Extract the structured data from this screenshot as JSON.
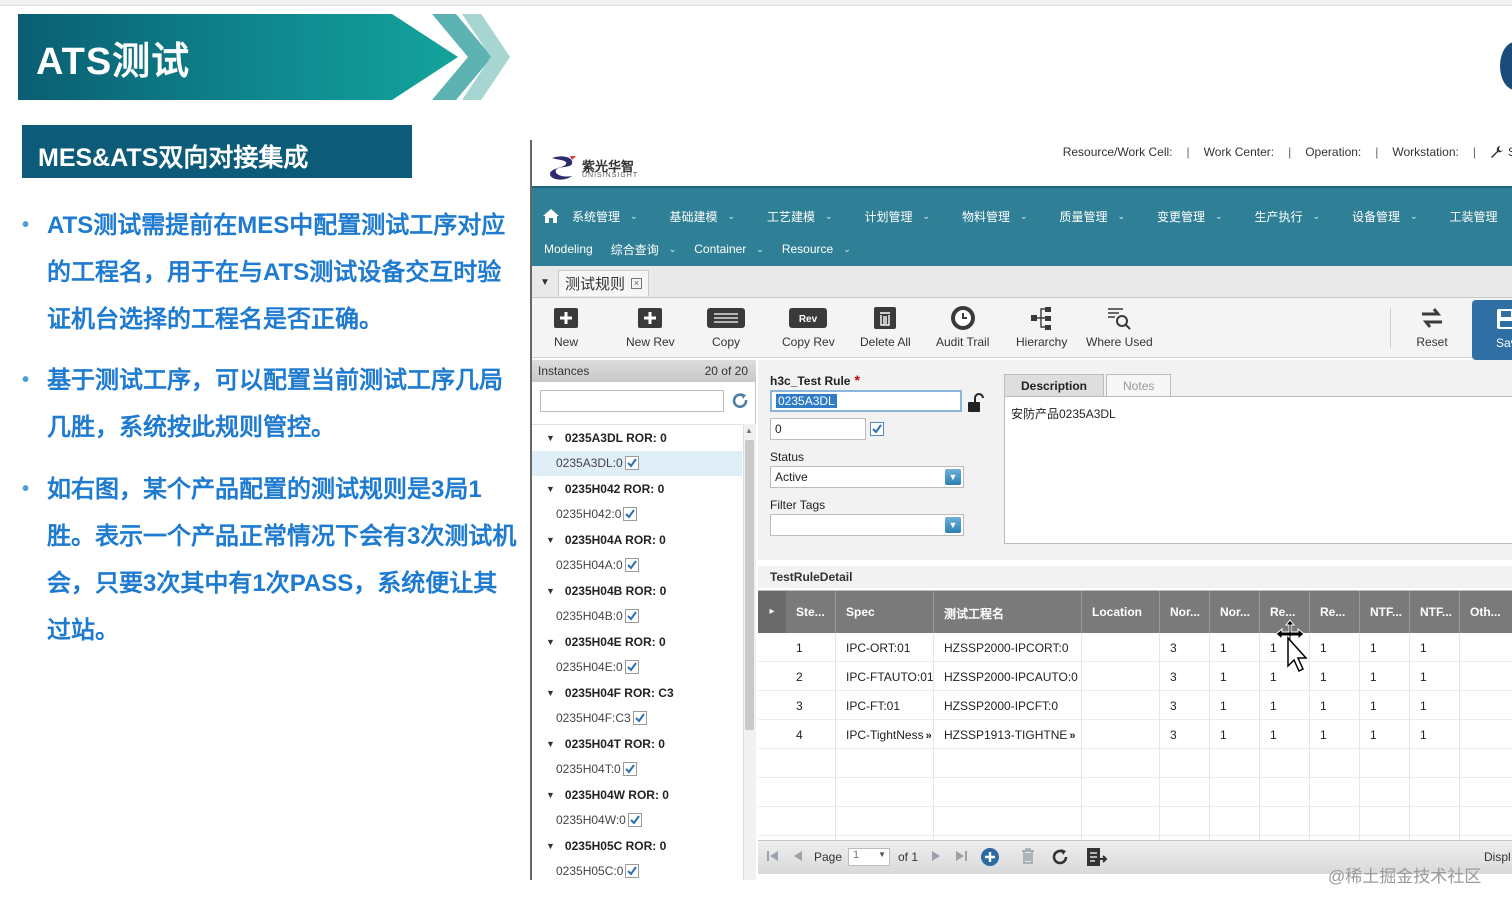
{
  "slide": {
    "title": "ATS测试",
    "subtitle": "MES&ATS双向对接集成",
    "bullets": [
      "ATS测试需提前在MES中配置测试工序对应的工程名，用于在与ATS测试设备交互时验证机台选择的工程名是否正确。",
      "基于测试工序，可以配置当前测试工序几局几胜，系统按此规则管控。",
      "如右图，某个产品配置的测试规则是3局1胜。表示一个产品正常情况下会有3次测试机会，只要3次其中有1次PASS，系统便让其过站。"
    ],
    "bullet_glyph": "•"
  },
  "app": {
    "logo_text": "紫光华智",
    "logo_sub": "UNISINSIGHT",
    "work_context": [
      "Resource/Work Cell:",
      "Work Center:",
      "Operation:",
      "Workstation:"
    ],
    "separator": "|",
    "settings_label": "S",
    "menu_row1": [
      "系统管理",
      "基础建模",
      "工艺建模",
      "计划管理",
      "物料管理",
      "质量管理",
      "变更管理",
      "生产执行",
      "设备管理",
      "工装管理"
    ],
    "menu_row2": [
      {
        "label": "Modeling",
        "chevron": false
      },
      {
        "label": "综合查询",
        "chevron": true
      },
      {
        "label": "Container",
        "chevron": true
      },
      {
        "label": "Resource",
        "chevron": true
      }
    ],
    "chevron_glyph": "⌄",
    "tab": {
      "label": "测试规则",
      "close": "×"
    },
    "toolbar": [
      "New",
      "New Rev",
      "Copy",
      "Copy Rev",
      "Delete All",
      "Audit Trail",
      "Hierarchy",
      "Where Used",
      "Reset",
      "Save"
    ],
    "rev_icon_text": "Rev",
    "instances": {
      "title": "Instances",
      "count": "20 of 20",
      "items": [
        {
          "label": "0235A3DL ROR: 0",
          "type": "group"
        },
        {
          "label": "0235A3DL:0",
          "type": "child",
          "selected": true
        },
        {
          "label": "0235H042 ROR: 0",
          "type": "group"
        },
        {
          "label": "0235H042:0",
          "type": "child"
        },
        {
          "label": "0235H04A ROR: 0",
          "type": "group"
        },
        {
          "label": "0235H04A:0",
          "type": "child"
        },
        {
          "label": "0235H04B ROR: 0",
          "type": "group"
        },
        {
          "label": "0235H04B:0",
          "type": "child"
        },
        {
          "label": "0235H04E ROR: 0",
          "type": "group"
        },
        {
          "label": "0235H04E:0",
          "type": "child"
        },
        {
          "label": "0235H04F ROR: C3",
          "type": "group"
        },
        {
          "label": "0235H04F:C3",
          "type": "child"
        },
        {
          "label": "0235H04T ROR: 0",
          "type": "group"
        },
        {
          "label": "0235H04T:0",
          "type": "child"
        },
        {
          "label": "0235H04W ROR: 0",
          "type": "group"
        },
        {
          "label": "0235H04W:0",
          "type": "child"
        },
        {
          "label": "0235H05C ROR: 0",
          "type": "group"
        },
        {
          "label": "0235H05C:0",
          "type": "child"
        }
      ]
    },
    "form": {
      "name_label": "h3c_Test Rule",
      "required_mark": "*",
      "name_value": "0235A3DL",
      "revision_value": "0",
      "status_label": "Status",
      "status_value": "Active",
      "filter_tags_label": "Filter Tags",
      "filter_tags_value": "",
      "desc_tab": "Description",
      "notes_tab": "Notes",
      "description": "安防产品0235A3DL"
    },
    "grid": {
      "title": "TestRuleDetail",
      "expand_glyph": "▸",
      "more_glyph": "»",
      "columns": [
        "Ste...",
        "Spec",
        "测试工程名",
        "Location",
        "Nor...",
        "Nor...",
        "Re...",
        "Re...",
        "NTF...",
        "NTF...",
        "Oth..."
      ],
      "rows": [
        [
          "1",
          "IPC-ORT:01",
          "HZSSP2000-IPCORT:0",
          "",
          "3",
          "1",
          "1",
          "1",
          "1",
          "1",
          ""
        ],
        [
          "2",
          "IPC-FTAUTO:01",
          "HZSSP2000-IPCAUTO:0",
          "",
          "3",
          "1",
          "1",
          "1",
          "1",
          "1",
          ""
        ],
        [
          "3",
          "IPC-FT:01",
          "HZSSP2000-IPCFT:0",
          "",
          "3",
          "1",
          "1",
          "1",
          "1",
          "1",
          ""
        ],
        [
          "4",
          "IPC-TightNess",
          "HZSSP1913-TIGHTNE",
          "",
          "3",
          "1",
          "1",
          "1",
          "1",
          "1",
          ""
        ]
      ]
    },
    "pager": {
      "page_label": "Page",
      "page_value": "1",
      "of_label": "of 1",
      "display_label": "Displ"
    }
  },
  "watermark": "@稀土掘金技术社区",
  "colors": {
    "accent": "#1e7bd0",
    "menu": "#2f8096",
    "banner": "#0c5b78"
  }
}
